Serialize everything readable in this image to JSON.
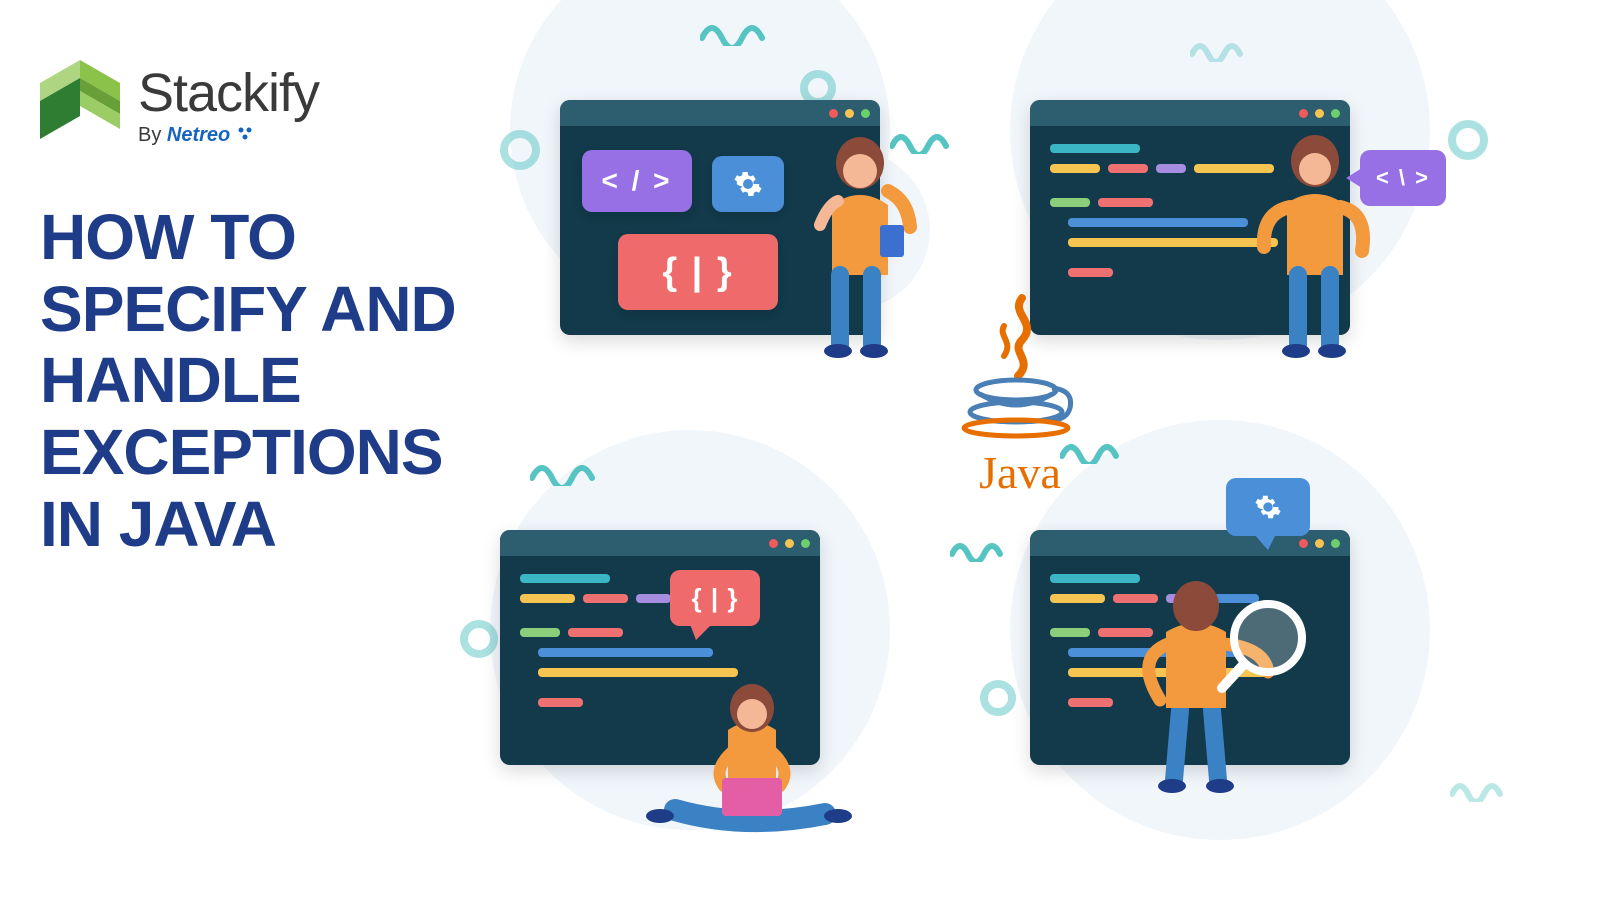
{
  "brand": {
    "name": "Stackify",
    "byline_prefix": "By ",
    "byline_brand": "Netreo"
  },
  "headline": "HOW TO SPECIFY AND HANDLE EXCEPTIONS IN JAVA",
  "java": {
    "word": "Java"
  },
  "badges": {
    "code_tag": "< / >",
    "braces": "{ | }",
    "close_tag": "< \\ >"
  },
  "colors": {
    "brand_blue": "#1f3c88",
    "accent_orange": "#e76f00"
  }
}
